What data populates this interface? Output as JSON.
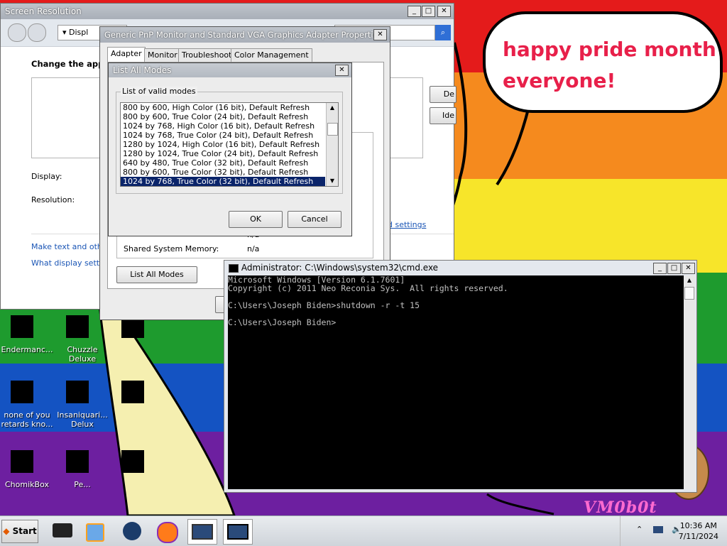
{
  "colors": {
    "red": "#e41b1b",
    "orange": "#f58a1e",
    "yellow": "#f7e52a",
    "green": "#1e9b2e",
    "blue": "#1453c2",
    "purple": "#6d1fa0",
    "selection": "#0a246a"
  },
  "wallpaper": {
    "speech_line1": "happy pride month",
    "speech_line2": "everyone!",
    "watermark": "VM0b0t"
  },
  "desktop_icons": [
    {
      "label": "Endermanc...",
      "icon": "app-icon"
    },
    {
      "label": "Chuzzle Deluxe",
      "icon": "game-icon"
    },
    {
      "label": "",
      "icon": "app-icon"
    },
    {
      "label": "none of you retards kno...",
      "icon": "chrome-icon"
    },
    {
      "label": "Insaniquari... Delux",
      "icon": "fish-icon"
    },
    {
      "label": "",
      "icon": "archive-icon"
    },
    {
      "label": "ChomikBox",
      "icon": "hamster-icon"
    },
    {
      "label": "Pe...",
      "icon": "app-icon"
    },
    {
      "label": "",
      "icon": "app-icon"
    }
  ],
  "screen_resolution": {
    "title": "Screen Resolution",
    "address_text": "Displ",
    "heading": "Change the appe",
    "display_label": "Display:",
    "resolution_label": "Resolution:",
    "link_text_size": "Make text and other",
    "link_display_settings": "What display setting",
    "advanced_settings_link": "d settings",
    "side_btn_1": "De",
    "side_btn_2": "Ide"
  },
  "properties": {
    "title": "Generic PnP Monitor and Standard VGA Graphics Adapter Properties",
    "tabs": [
      "Adapter",
      "Monitor",
      "Troubleshoot",
      "Color Management"
    ],
    "shared_memory_label": "Shared System Memory:",
    "shared_memory_value": "n/a",
    "system_video_memory_value": "n/a",
    "list_all_modes_button": "List All Modes"
  },
  "list_all_modes": {
    "title": "List All Modes",
    "group_label": "List of valid modes",
    "modes": [
      "800 by 600, High Color (16 bit), Default Refresh",
      "800 by 600, True Color (24 bit), Default Refresh",
      "1024 by 768, High Color (16 bit), Default Refresh",
      "1024 by 768, True Color (24 bit), Default Refresh",
      "1280 by 1024, High Color (16 bit), Default Refresh",
      "1280 by 1024, True Color (24 bit), Default Refresh",
      "640 by 480, True Color (32 bit), Default Refresh",
      "800 by 600, True Color (32 bit), Default Refresh",
      "1024 by 768, True Color (32 bit), Default Refresh"
    ],
    "selected_index": 8,
    "ok_label": "OK",
    "cancel_label": "Cancel"
  },
  "cmd": {
    "title": "Administrator: C:\\Windows\\system32\\cmd.exe",
    "lines": [
      "Microsoft Windows [Version 6.1.7601]",
      "Copyright (c) 2011 Neo Reconia Sys.  All rights reserved.",
      "",
      "C:\\Users\\Joseph Biden>shutdown -r -t 15",
      "",
      "C:\\Users\\Joseph Biden>"
    ]
  },
  "taskbar": {
    "start_label": "Start",
    "pinned": [
      "app-icon",
      "media-player-icon",
      "globe-icon",
      "firefox-icon",
      "display-settings-icon",
      "cmd-icon"
    ],
    "time": "10:36 AM",
    "date": "7/11/2024"
  }
}
